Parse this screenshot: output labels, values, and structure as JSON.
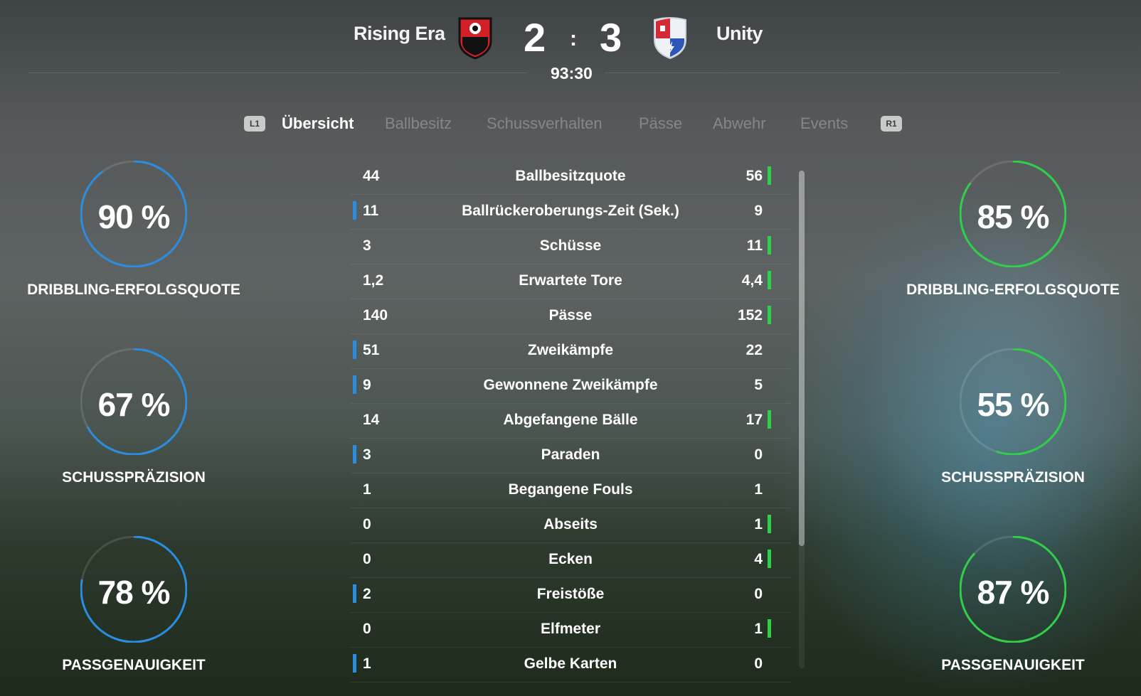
{
  "match": {
    "home_team": "Rising Era",
    "away_team": "Unity",
    "home_score": "2",
    "separator": ":",
    "away_score": "3",
    "clock": "93:30"
  },
  "tabs": {
    "left_button": "L1",
    "right_button": "R1",
    "items": [
      "Übersicht",
      "Ballbesitz",
      "Schussverhalten",
      "Pässe",
      "Abwehr",
      "Events"
    ],
    "active_index": 0
  },
  "home_gauges": [
    {
      "value": "90 %",
      "fraction": 0.9,
      "label": "DRIBBLING-ERFOLGSQUOTE"
    },
    {
      "value": "67 %",
      "fraction": 0.67,
      "label": "SCHUSSPRÄZISION"
    },
    {
      "value": "78 %",
      "fraction": 0.78,
      "label": "PASSGENAUIGKEIT"
    }
  ],
  "away_gauges": [
    {
      "value": "85 %",
      "fraction": 0.85,
      "label": "DRIBBLING-ERFOLGSQUOTE"
    },
    {
      "value": "55 %",
      "fraction": 0.55,
      "label": "SCHUSSPRÄZISION"
    },
    {
      "value": "87 %",
      "fraction": 0.87,
      "label": "PASSGENAUIGKEIT"
    }
  ],
  "colors": {
    "home_accent": "#2a8de0",
    "away_accent": "#2fcf4a"
  },
  "stats": [
    {
      "home": "44",
      "label": "Ballbesitzquote",
      "away": "56",
      "leader": "away"
    },
    {
      "home": "11",
      "label": "Ballrückeroberungs-Zeit (Sek.)",
      "away": "9",
      "leader": "home"
    },
    {
      "home": "3",
      "label": "Schüsse",
      "away": "11",
      "leader": "away"
    },
    {
      "home": "1,2",
      "label": "Erwartete Tore",
      "away": "4,4",
      "leader": "away"
    },
    {
      "home": "140",
      "label": "Pässe",
      "away": "152",
      "leader": "away"
    },
    {
      "home": "51",
      "label": "Zweikämpfe",
      "away": "22",
      "leader": "home"
    },
    {
      "home": "9",
      "label": "Gewonnene Zweikämpfe",
      "away": "5",
      "leader": "home"
    },
    {
      "home": "14",
      "label": "Abgefangene Bälle",
      "away": "17",
      "leader": "away"
    },
    {
      "home": "3",
      "label": "Paraden",
      "away": "0",
      "leader": "home"
    },
    {
      "home": "1",
      "label": "Begangene Fouls",
      "away": "1",
      "leader": "none"
    },
    {
      "home": "0",
      "label": "Abseits",
      "away": "1",
      "leader": "away"
    },
    {
      "home": "0",
      "label": "Ecken",
      "away": "4",
      "leader": "away"
    },
    {
      "home": "2",
      "label": "Freistöße",
      "away": "0",
      "leader": "home"
    },
    {
      "home": "0",
      "label": "Elfmeter",
      "away": "1",
      "leader": "away"
    },
    {
      "home": "1",
      "label": "Gelbe Karten",
      "away": "0",
      "leader": "home"
    }
  ]
}
